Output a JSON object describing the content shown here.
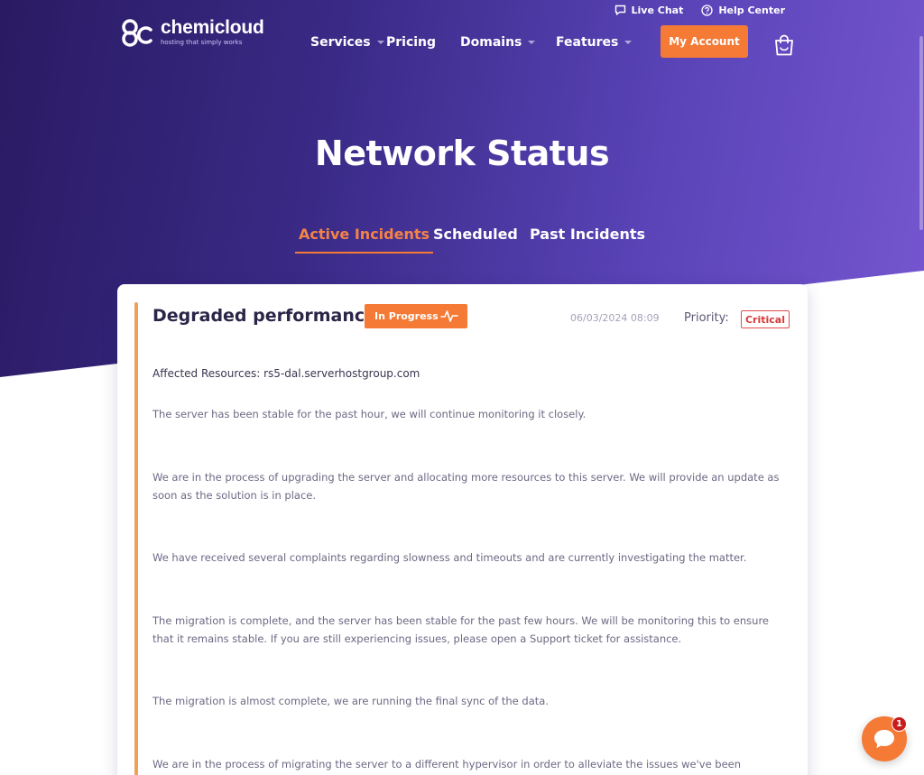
{
  "brand": {
    "name": "chemicloud",
    "tagline": "hosting that simply works",
    "colors": {
      "primary": "#3a2a86",
      "accent": "#f47a35",
      "critical": "#d63a3a"
    }
  },
  "topbar": {
    "live_chat": "Live Chat",
    "help_center": "Help Center"
  },
  "nav": {
    "items": [
      {
        "label": "Services",
        "dropdown": true
      },
      {
        "label": "Pricing",
        "dropdown": false
      },
      {
        "label": "Domains",
        "dropdown": true
      },
      {
        "label": "Features",
        "dropdown": true
      }
    ],
    "account_button": "My Account",
    "cart_icon": "shopping-bag-icon"
  },
  "page": {
    "title": "Network Status"
  },
  "tabs": [
    {
      "label": "Active Incidents",
      "active": true
    },
    {
      "label": "Scheduled",
      "active": false
    },
    {
      "label": "Past Incidents",
      "active": false
    }
  ],
  "incident": {
    "title": "Degraded performance",
    "status": "In Progress",
    "status_icon": "pulse-icon",
    "timestamp": "06/03/2024 08:09",
    "priority_label": "Priority:",
    "priority": "Critical",
    "affected_resources": "Affected Resources: rs5-dal.serverhostgroup.com",
    "updates": [
      "The server has been stable for the past hour, we will continue monitoring it closely.",
      "We are in the process of upgrading the server and allocating more resources to this server. We will provide an update as soon as the solution is in place.",
      "We have received several complaints regarding slowness and timeouts and are currently investigating the matter.",
      "The migration is complete, and the server has been stable for the past few hours. We will be monitoring this to ensure that it remains stable. If you are still experiencing issues, please open a Support ticket for assistance.",
      "The migration is almost complete, we are running the final sync of the data.",
      "We are in the process of migrating the server to a different hypervisor in order to alleviate the issues we've been experiencing"
    ]
  },
  "chat_widget": {
    "icon": "chat-bubble-icon",
    "unread_count": "1"
  }
}
